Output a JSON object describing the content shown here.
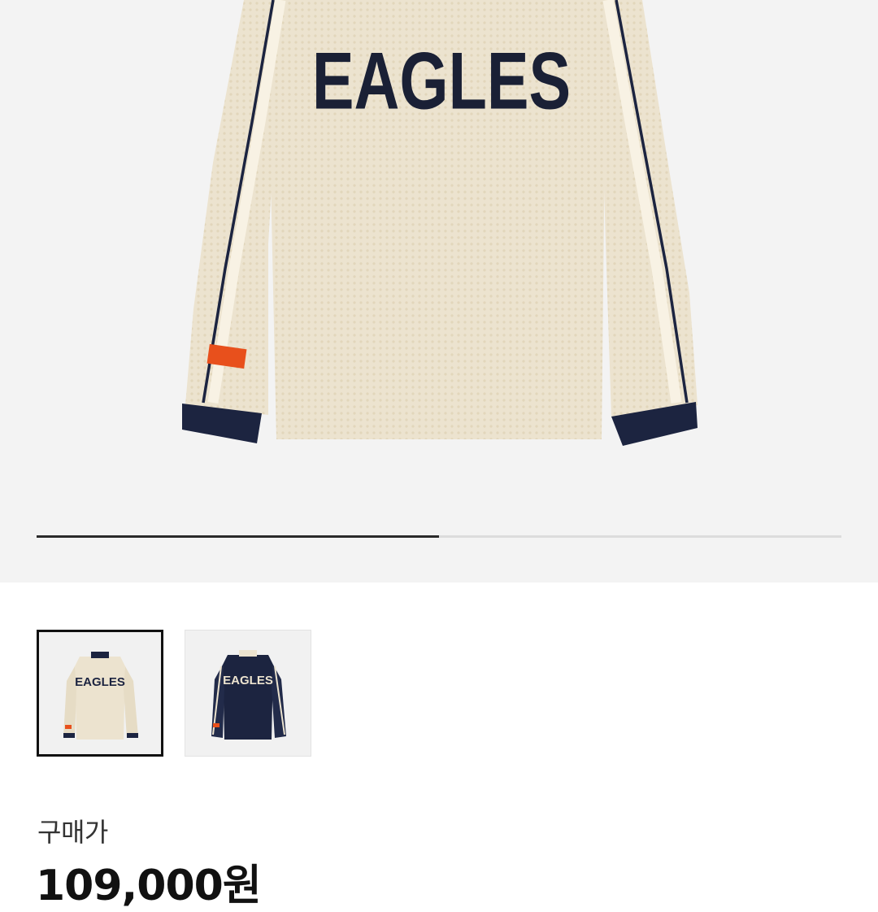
{
  "gallery": {
    "main_image_alt": "EAGLES mesh long-sleeve jersey, cream",
    "jersey_wordmark": "EAGLES",
    "progress_fraction": 0.5,
    "thumbnails": [
      {
        "wordmark": "EAGLES",
        "colorway": "cream",
        "selected": true
      },
      {
        "wordmark": "EAGLES",
        "colorway": "navy",
        "selected": false
      }
    ]
  },
  "purchase": {
    "price_label": "구매가",
    "price": "109,000원"
  },
  "colors": {
    "cream": "#ece3cf",
    "navy": "#1c2440",
    "accent_orange": "#e8501c"
  }
}
